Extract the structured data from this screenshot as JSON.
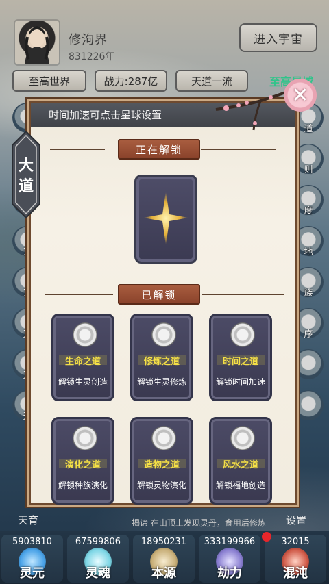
{
  "header": {
    "player_name": "修泃界",
    "player_year": "831226年",
    "enter_universe": "进入宇宙",
    "tags": [
      "至高世界",
      "战力:287亿",
      "天道一流",
      "至高星域"
    ]
  },
  "left_column_labels": [
    "天",
    "天",
    "天",
    "天",
    "天",
    "天",
    "天育"
  ],
  "right_column_labels": [
    "道",
    "则",
    "度",
    "地",
    "族",
    "序",
    "设置"
  ],
  "modal": {
    "title": "时间加速可点击星球设置",
    "side_tab": "大\n道",
    "unlocking_title": "正在解锁",
    "unlocked_title": "已解锁",
    "cards": [
      {
        "name": "生命之道",
        "desc": "解锁生灵创造"
      },
      {
        "name": "修炼之道",
        "desc": "解锁生灵修炼"
      },
      {
        "name": "时间之道",
        "desc": "解锁时间加速"
      },
      {
        "name": "演化之道",
        "desc": "解锁种族演化"
      },
      {
        "name": "造物之道",
        "desc": "解锁灵物演化"
      },
      {
        "name": "风水之道",
        "desc": "解锁福地创造"
      }
    ],
    "close_symbol": "✕"
  },
  "bottom": {
    "ticker": "揭谛 在山顶上发现灵丹，食用后修炼",
    "settings": "设置",
    "tianyu": "天育",
    "resources": [
      {
        "value": "5903810",
        "label": "灵元",
        "color": "#4aa3e8"
      },
      {
        "value": "67599806",
        "label": "灵魂",
        "color": "#7fd7e6"
      },
      {
        "value": "18950231",
        "label": "本源",
        "color": "#c9b07a"
      },
      {
        "value": "333199966",
        "label": "劫力",
        "color": "#8a7fd1"
      },
      {
        "value": "32015",
        "label": "混沌",
        "color": "#d05a48"
      }
    ]
  }
}
